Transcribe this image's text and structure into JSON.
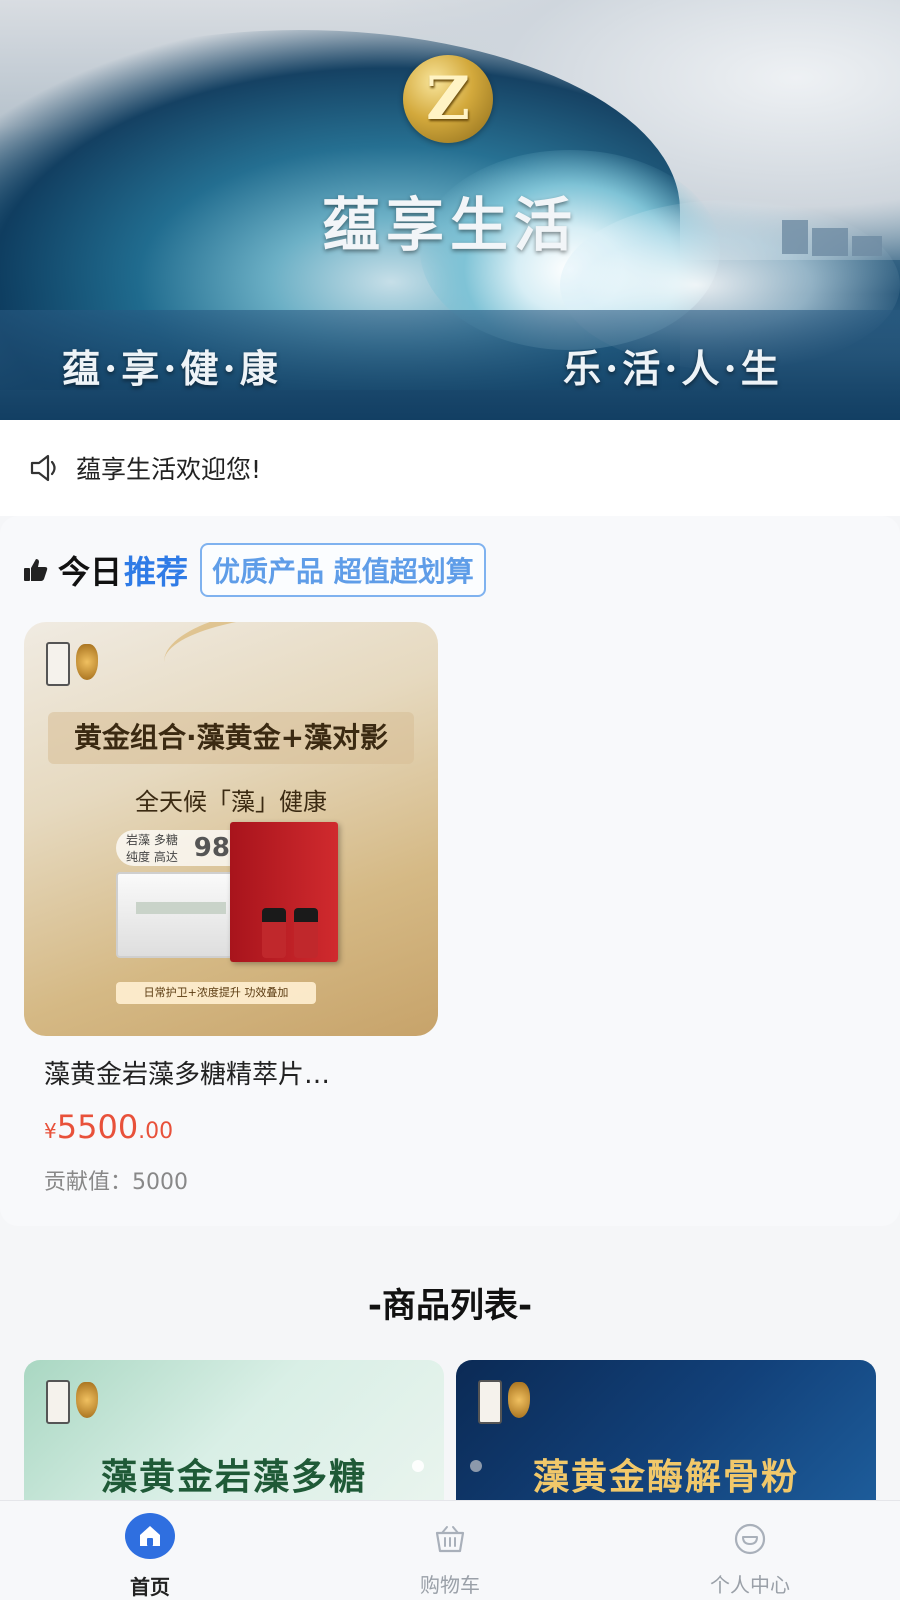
{
  "banner": {
    "logo_letter": "Z",
    "title": "蕴享生活",
    "slogan_left": "蕴·享·健·康",
    "slogan_right": "乐·活·人·生"
  },
  "notice": {
    "icon": "speaker-icon",
    "text": "蕴享生活欢迎您!"
  },
  "recommend": {
    "icon": "thumbs-up-icon",
    "title_part1": "今日",
    "title_part2": "推荐",
    "tag": "优质产品 超值超划算",
    "product": {
      "image": {
        "headline": "黄金组合·藻黄金+藻对影",
        "subline": "全天候「藻」健康",
        "badge_text": "岩藻 多糖 纯度 高达",
        "badge_value": "98%",
        "bottom_tag": "日常护卫+浓度提升 功效叠加"
      },
      "name": "藻黄金岩藻多糖精萃片…",
      "price_currency": "¥",
      "price_int": "5500",
      "price_dec": ".00",
      "contribution": "贡献值：5000"
    }
  },
  "product_list": {
    "title": "-商品列表-",
    "cards": [
      {
        "title": "藻黄金岩藻多糖"
      },
      {
        "title": "藻黄金酶解骨粉"
      }
    ]
  },
  "tabbar": {
    "tabs": [
      {
        "label": "首页",
        "icon": "home-icon",
        "active": true
      },
      {
        "label": "购物车",
        "icon": "cart-icon",
        "active": false
      },
      {
        "label": "个人中心",
        "icon": "profile-icon",
        "active": false
      }
    ],
    "accent_color": "#2f6fe0"
  },
  "colors": {
    "accent_blue": "#2f7be6",
    "price_red": "#e8513a"
  }
}
